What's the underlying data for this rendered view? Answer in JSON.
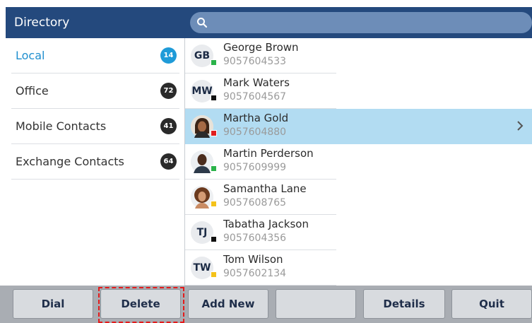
{
  "header": {
    "title": "Directory"
  },
  "search": {
    "placeholder": ""
  },
  "categories": [
    {
      "label": "Local",
      "count": "14",
      "active": true
    },
    {
      "label": "Office",
      "count": "72"
    },
    {
      "label": "Mobile Contacts",
      "count": "41"
    },
    {
      "label": "Exchange Contacts",
      "count": "64"
    }
  ],
  "contacts": [
    {
      "initials": "GB",
      "name": "George Brown",
      "number": "9057604533",
      "presence": "#2bb34a"
    },
    {
      "initials": "MW",
      "name": "Mark Waters",
      "number": "9057604567",
      "presence": "#111111"
    },
    {
      "initials": "",
      "name": "Martha Gold",
      "number": "9057604880",
      "presence": "#e01e1e",
      "selected": true,
      "photo": "woman-photo"
    },
    {
      "initials": "",
      "name": "Martin Perderson",
      "number": "9057609999",
      "presence": "#2bb34a",
      "photo": "man-photo"
    },
    {
      "initials": "",
      "name": "Samantha Lane",
      "number": "9057608765",
      "presence": "#f4c21a",
      "photo": "woman-photo"
    },
    {
      "initials": "TJ",
      "name": "Tabatha Jackson",
      "number": "9057604356",
      "presence": "#111111"
    },
    {
      "initials": "TW",
      "name": "Tom Wilson",
      "number": "9057602134",
      "presence": "#f4c21a"
    }
  ],
  "softkeys": {
    "dial": "Dial",
    "delete": "Delete",
    "add_new": "Add New",
    "blank": "",
    "details": "Details",
    "quit": "Quit"
  },
  "colors": {
    "header": "#24497d",
    "accent": "#1f8fcf",
    "selected_row": "#b2dcf2",
    "highlight_box": "#e31b1b"
  }
}
